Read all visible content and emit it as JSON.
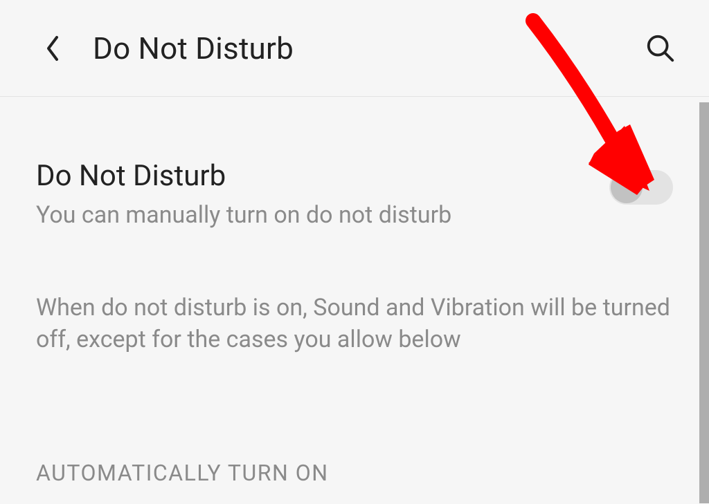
{
  "header": {
    "title": "Do Not Disturb"
  },
  "setting": {
    "title": "Do Not Disturb",
    "subtitle": "You can manually turn on do not disturb",
    "toggle_on": false
  },
  "info": "When do not disturb is on, Sound and Vibration will be turned off, except for the cases you allow below",
  "section_header": "AUTOMATICALLY TURN ON",
  "colors": {
    "arrow": "#ff0000",
    "text_primary": "#222222",
    "text_secondary": "#8a8a8a",
    "toggle_track_off": "#e3e3e3",
    "toggle_knob_off": "#c2c2c2",
    "background": "#f6f6f6"
  },
  "icons": {
    "back": "chevron-left-icon",
    "search": "search-icon"
  }
}
